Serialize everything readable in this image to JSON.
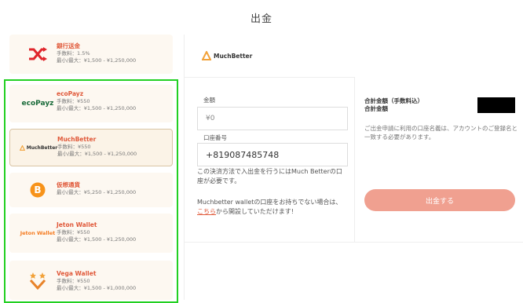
{
  "page": {
    "title": "出金"
  },
  "methods": [
    {
      "name": "銀行送金",
      "line1": "手数料：1.5%",
      "line2": "最小/最大：¥1,500 - ¥1,250,000"
    },
    {
      "name": "ecoPayz",
      "logo": "ecoPayz",
      "line1": "手数料：¥550",
      "line2": "最小/最大：¥1,500 - ¥1,250,000"
    },
    {
      "name": "MuchBetter",
      "logo": "MuchBetter",
      "line1": "手数料：¥550",
      "line2": "最小/最大：¥1,500 - ¥1,250,000"
    },
    {
      "name": "仮想通貨",
      "line1": "最小/最大：¥5,250 - ¥1,250,000"
    },
    {
      "name": "Jeton Wallet",
      "logo": "Jeton Wallet",
      "line1": "手数料：¥550",
      "line2": "最小/最大：¥1,500 - ¥1,250,000"
    },
    {
      "name": "Vega Wallet",
      "line1": "手数料：¥550",
      "line2": "最小/最大：¥1,500 - ¥1,000,000"
    }
  ],
  "colors": {
    "accent": "#e0593a",
    "button": "#f0a090",
    "highlight": "#22d022"
  },
  "header": {
    "logo_text": "MuchBetter"
  },
  "form": {
    "amount_label": "金額",
    "amount_value": "¥0",
    "phone_label": "口座番号",
    "phone_value": "+819087485748",
    "note1": "この決済方法で入出金を行うにはMuch Betterの口座が必要です。",
    "note2_a": "Muchbetter walletの口座をお持ちでない場合は、",
    "note2_link": "こちら",
    "note2_b": "から開設していただけます!"
  },
  "summary": {
    "total_label": "合計金額（手数料込）",
    "total_label2": "合計金額",
    "note": "ご出金申請に利用の口座名義は、アカウントのご登録名と一致する必要があります。",
    "submit_label": "出金する"
  }
}
